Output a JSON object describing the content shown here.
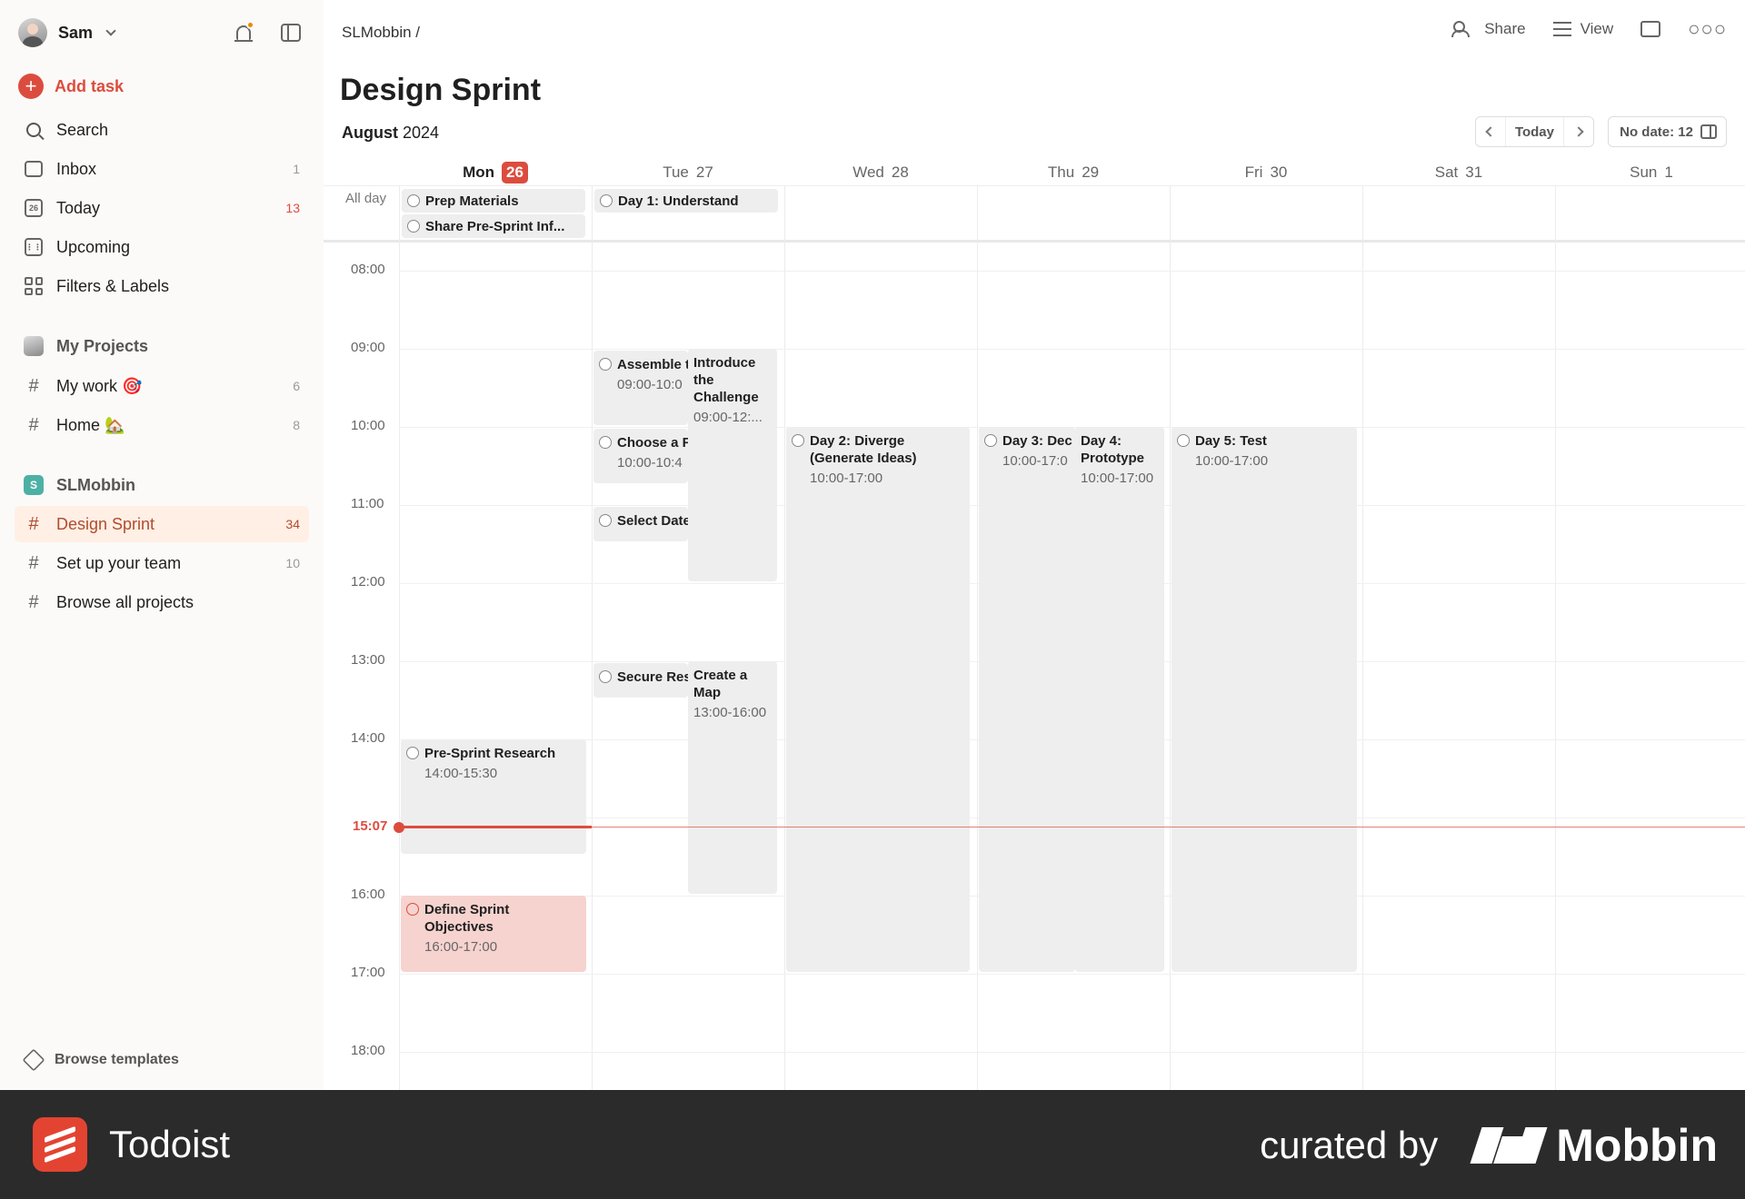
{
  "user": {
    "name": "Sam"
  },
  "sidebar": {
    "add_task": "Add task",
    "nav": [
      {
        "label": "Search",
        "count": ""
      },
      {
        "label": "Inbox",
        "count": "1"
      },
      {
        "label": "Today",
        "count": "13",
        "today_day": "26"
      },
      {
        "label": "Upcoming",
        "count": ""
      },
      {
        "label": "Filters & Labels",
        "count": ""
      }
    ],
    "my_projects": {
      "heading": "My Projects",
      "items": [
        {
          "label": "My work 🎯",
          "count": "6"
        },
        {
          "label": "Home 🏡",
          "count": "8"
        }
      ]
    },
    "team": {
      "badge": "S",
      "heading": "SLMobbin",
      "items": [
        {
          "label": "Design Sprint",
          "count": "34"
        },
        {
          "label": "Set up your team",
          "count": "10"
        },
        {
          "label": "Browse all projects",
          "count": ""
        }
      ]
    },
    "browse_templates": "Browse templates"
  },
  "header": {
    "breadcrumb": "SLMobbin /",
    "share": "Share",
    "view": "View",
    "title": "Design Sprint",
    "month": "August",
    "year": "2024",
    "today_btn": "Today",
    "no_date": "No date: 12"
  },
  "calendar": {
    "days": [
      {
        "name": "Mon",
        "num": "26"
      },
      {
        "name": "Tue",
        "num": "27"
      },
      {
        "name": "Wed",
        "num": "28"
      },
      {
        "name": "Thu",
        "num": "29"
      },
      {
        "name": "Fri",
        "num": "30"
      },
      {
        "name": "Sat",
        "num": "31"
      },
      {
        "name": "Sun",
        "num": "1"
      }
    ],
    "all_day_label": "All day",
    "hours": [
      "08:00",
      "09:00",
      "10:00",
      "11:00",
      "12:00",
      "13:00",
      "14:00",
      "16:00",
      "17:00",
      "18:00"
    ],
    "now": "15:07",
    "all_day_events": [
      {
        "title": "Prep Materials"
      },
      {
        "title": "Share Pre-Sprint Inf..."
      },
      {
        "title": "Day 1: Understand"
      }
    ],
    "events": [
      {
        "title": "Assemble t",
        "time": "09:00-10:0"
      },
      {
        "title": "Introduce the Challenge",
        "time": "09:00-12:..."
      },
      {
        "title": "Choose a F",
        "time": "10:00-10:4"
      },
      {
        "title": "Select Date"
      },
      {
        "title": "Secure Res"
      },
      {
        "title": "Create a Map",
        "time": "13:00-16:00"
      },
      {
        "title": "Pre-Sprint Research",
        "time": "14:00-15:30"
      },
      {
        "title": "Define Sprint Objectives",
        "time": "16:00-17:00"
      },
      {
        "title": "Day 2: Diverge (Generate Ideas)",
        "time": "10:00-17:00"
      },
      {
        "title": "Day 3: Dec",
        "time": "10:00-17:0"
      },
      {
        "title": "Day 4: Prototype",
        "time": "10:00-17:00"
      },
      {
        "title": "Day 5: Test",
        "time": "10:00-17:00"
      }
    ]
  },
  "footer": {
    "app_name": "Todoist",
    "curated_by": "curated by",
    "curator": "Mobbin"
  },
  "colors": {
    "accent": "#dc4c3e",
    "sidebar_bg": "#fcfaf8",
    "active_item_bg": "#ffefe5",
    "event_bg": "#eeeeee",
    "event_overdue_bg": "#f6d3cf",
    "footer_bg": "#2b2b2b"
  }
}
